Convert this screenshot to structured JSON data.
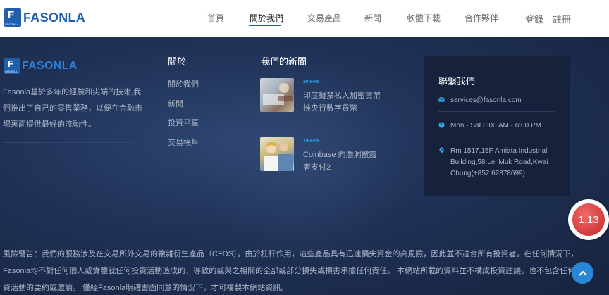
{
  "brand": {
    "name": "FASONLA",
    "logo_letter": "F",
    "logo_sub": "FASONLA"
  },
  "nav": [
    {
      "label": "首頁",
      "active": false
    },
    {
      "label": "關於我們",
      "active": true
    },
    {
      "label": "交易產品",
      "active": false
    },
    {
      "label": "新聞",
      "active": false
    },
    {
      "label": "軟體下載",
      "active": false
    },
    {
      "label": "合作夥伴",
      "active": false
    }
  ],
  "auth": {
    "login": "登錄",
    "register": "註冊"
  },
  "about": {
    "text": "Fasonla基於多年的經驗和尖端的技術,我們推出了自己的零售業務，以便在金融市場裏面提供最好的流動性。"
  },
  "links": {
    "title": "關於",
    "items": [
      "關於我們",
      "新聞",
      "投資平臺",
      "交易帳戶"
    ]
  },
  "news": {
    "title": "我們的新聞",
    "items": [
      {
        "date": "20 Feb",
        "title": "印度擬禁私人加密貨幣 推央行數字貨幣"
      },
      {
        "date": "19 Feb",
        "title": "Coinbase 向潛洞披露者支付2"
      }
    ]
  },
  "contact": {
    "title": "聯繫我們",
    "email": "services@fasonla.com",
    "hours": "Mon - Sat 8:00 AM - 6:00 PM",
    "address": "Rm 1517,15F Amiata Industrial Building,58 Lei Muk Road,Kwai Chung(+852 62878699)"
  },
  "risk_warning": "風險警告：我們的服務涉及在交易所外交易的複雜衍生產品（CFDS）。由於杠杆作用，這些產品具有迅速損失資金的高風險，因此並不適合所有投資者。在任何情況下，Fasonla均不對任何個人或實體就任何投資活動造成的、導致的或與之相關的全部或部分損失或損害承擔任何責任。 本網站所載的資料並不構成投資建議，也不包含任何投資活動的要約或邀請。 僅經Fasonla明確書面同意的情況下，才可複製本網站資訊。",
  "badge": {
    "value": "1.13"
  },
  "colors": {
    "brand": "#1f5fae",
    "accent": "#3aa4e8",
    "footer_bg": "#1b2a48",
    "badge": "#d23a3a"
  }
}
